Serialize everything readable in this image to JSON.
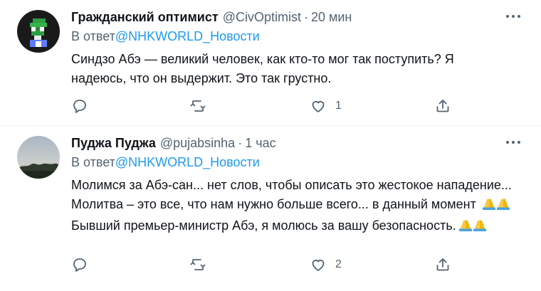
{
  "tweets": [
    {
      "name": "Гражданский оптимист",
      "handle": "@CivOptimist",
      "time": "20 мин",
      "reply_prefix": "В ответ",
      "reply_mention": "@NHKWORLD_Новости",
      "text": "Синдзо Абэ — великий человек, как кто-то мог так поступить? Я надеюсь, что он выдержит. Это так грустно.",
      "reply_count": "",
      "retweet_count": "",
      "like_count": "1",
      "avatar_icon": "pixel-art-avatar-icon"
    },
    {
      "name": "Пуджа Пуджа",
      "handle": "@pujabsinha",
      "time": "1 час",
      "reply_prefix": "В ответ",
      "reply_mention": "@NHKWORLD_Новости",
      "text_part1": "Молимся за Абэ-сан... нет слов, чтобы описать это жестокое нападение... Молитва – это все, что нам нужно больше всего... в данный момент ",
      "text_part2": "Бывший премьер-министр Абэ, я молюсь за вашу безопасность.",
      "reply_count": "",
      "retweet_count": "",
      "like_count": "2",
      "avatar_icon": "sunset-trees-avatar-icon"
    }
  ],
  "icons": {
    "reply": "reply-icon",
    "retweet": "retweet-icon",
    "like": "like-icon",
    "share": "share-icon",
    "more": "more-icon",
    "pray": "folded-hands-emoji-icon"
  },
  "colors": {
    "text": "#0f1419",
    "muted": "#536471",
    "link": "#1d9bf0",
    "divider": "#eff3f4"
  }
}
